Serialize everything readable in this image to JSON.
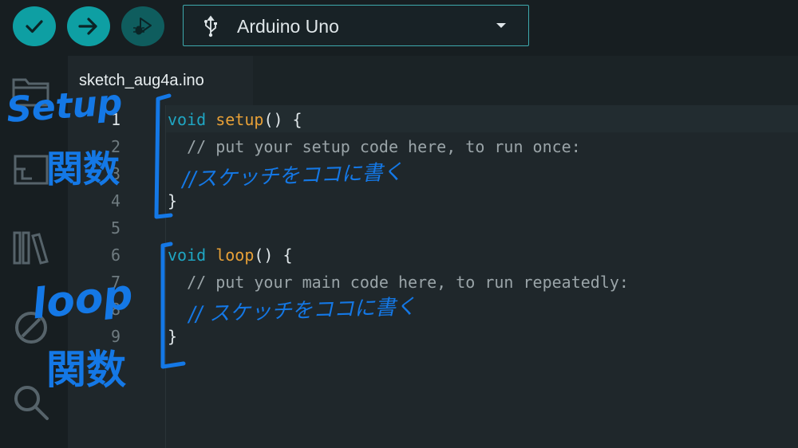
{
  "toolbar": {
    "verify_icon": "check-icon",
    "upload_icon": "arrow-right-icon",
    "debug_icon": "debug-icon",
    "board": {
      "name": "Arduino Uno",
      "icon": "usb-icon"
    }
  },
  "sidebar": {
    "items": [
      {
        "icon": "folder-icon"
      },
      {
        "icon": "boards-manager-icon"
      },
      {
        "icon": "library-icon"
      },
      {
        "icon": "debug-circle-icon"
      },
      {
        "icon": "search-icon"
      }
    ]
  },
  "editor": {
    "tab": {
      "filename": "sketch_aug4a.ino"
    },
    "lines": [
      {
        "num": "1",
        "kw": "void",
        "fn": "setup",
        "rest": "() {",
        "comment": ""
      },
      {
        "num": "2",
        "kw": "",
        "fn": "",
        "rest": "",
        "comment": "  // put your setup code here, to run once:"
      },
      {
        "num": "3",
        "kw": "",
        "fn": "",
        "rest": "",
        "comment": ""
      },
      {
        "num": "4",
        "kw": "",
        "fn": "",
        "rest": "}",
        "comment": ""
      },
      {
        "num": "5",
        "kw": "",
        "fn": "",
        "rest": "",
        "comment": ""
      },
      {
        "num": "6",
        "kw": "void",
        "fn": "loop",
        "rest": "() {",
        "comment": ""
      },
      {
        "num": "7",
        "kw": "",
        "fn": "",
        "rest": "",
        "comment": "  // put your main code here, to run repeatedly:"
      },
      {
        "num": "8",
        "kw": "",
        "fn": "",
        "rest": "",
        "comment": ""
      },
      {
        "num": "9",
        "kw": "",
        "fn": "",
        "rest": "}",
        "comment": ""
      }
    ]
  },
  "annotations": {
    "setup_label": "Setup",
    "setup_kanji": "関数",
    "setup_note": "//スケッチをココに書く",
    "loop_label": "loop",
    "loop_kanji": "関数",
    "loop_note": "// スケッチをココに書く",
    "ink_color": "#1478e6"
  },
  "colors": {
    "accent": "#0e9fa3",
    "keyword": "#1fa6c3",
    "function": "#e7a037",
    "background": "#171e21"
  }
}
